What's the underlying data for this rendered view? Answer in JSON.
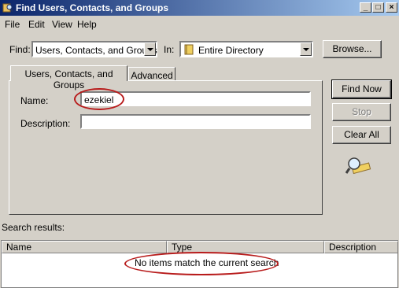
{
  "window": {
    "title": "Find Users, Contacts, and Groups",
    "min_label": "_",
    "max_label": "□",
    "close_label": "×"
  },
  "menu": {
    "file": "File",
    "edit": "Edit",
    "view": "View",
    "help": "Help"
  },
  "search": {
    "find_label": "Find:",
    "find_value": "Users, Contacts, and Groups",
    "in_label": "In:",
    "in_value": "Entire Directory",
    "browse_label": "Browse..."
  },
  "tabs": {
    "basic": "Users, Contacts, and Groups",
    "advanced": "Advanced"
  },
  "form": {
    "name_label": "Name:",
    "name_value": "ezekiel",
    "description_label": "Description:",
    "description_value": ""
  },
  "buttons": {
    "find_now": "Find Now",
    "stop": "Stop",
    "clear_all": "Clear All"
  },
  "results": {
    "label": "Search results:",
    "columns": [
      "Name",
      "Type",
      "Description"
    ],
    "empty_message": "No items match the current search"
  },
  "colors": {
    "annotation": "#b81c1c",
    "titlebar": "#0a246a",
    "face": "#d4d0c8"
  },
  "icons": {
    "window": "find-window-icon",
    "directory": "directory-book-icon",
    "search_decor": "magnifier-icon"
  }
}
